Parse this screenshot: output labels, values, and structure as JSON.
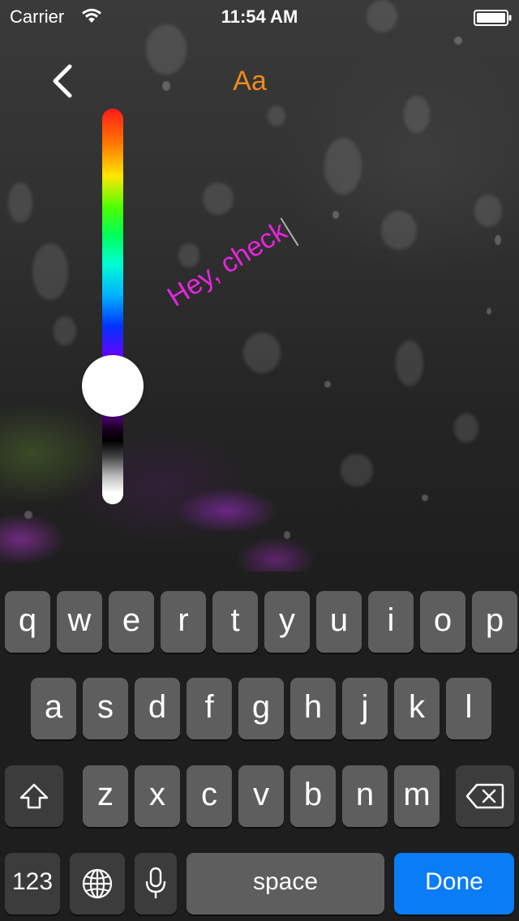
{
  "status_bar": {
    "carrier": "Carrier",
    "time": "11:54 AM"
  },
  "toolbar": {
    "back_icon": "chevron-left-icon",
    "font_label": "Aa",
    "font_color": "#f08a1c"
  },
  "editor": {
    "text": "Hey, check",
    "text_color": "#e625dc",
    "color_slider_value": 0.7
  },
  "keyboard": {
    "row1": [
      "q",
      "w",
      "e",
      "r",
      "t",
      "y",
      "u",
      "i",
      "o",
      "p"
    ],
    "row2": [
      "a",
      "s",
      "d",
      "f",
      "g",
      "h",
      "j",
      "k",
      "l"
    ],
    "row3": [
      "z",
      "x",
      "c",
      "v",
      "b",
      "n",
      "m"
    ],
    "numbers_label": "123",
    "space_label": "space",
    "done_label": "Done",
    "done_color": "#0a7cf5"
  }
}
